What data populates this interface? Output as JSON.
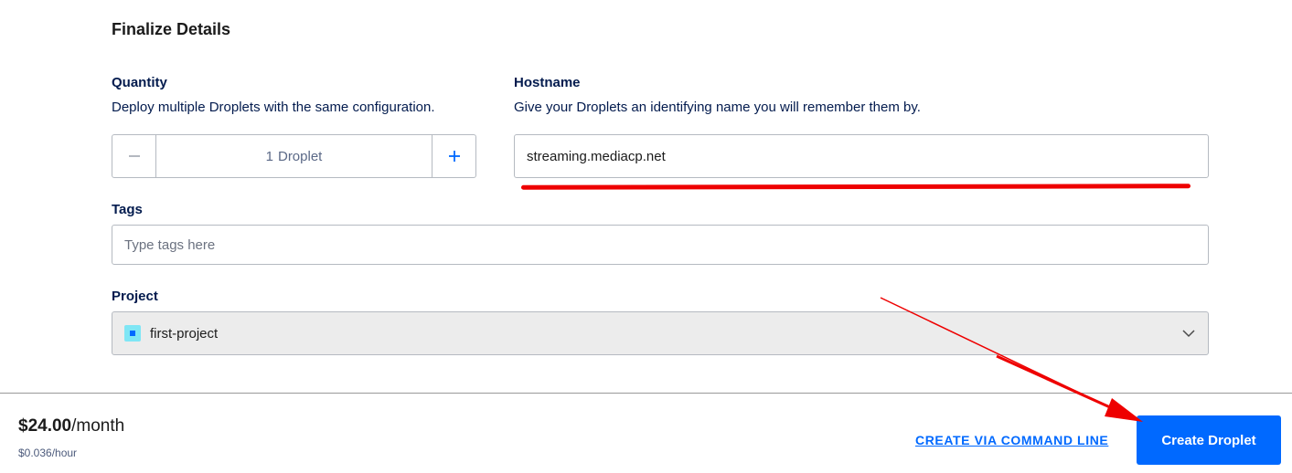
{
  "section": {
    "title": "Finalize Details"
  },
  "quantity": {
    "label": "Quantity",
    "description": "Deploy multiple Droplets with the same configuration.",
    "value": "1",
    "unit": "Droplet"
  },
  "hostname": {
    "label": "Hostname",
    "description": "Give your Droplets an identifying name you will remember them by.",
    "value": "streaming.mediacp.net"
  },
  "tags": {
    "label": "Tags",
    "placeholder": "Type tags here"
  },
  "project": {
    "label": "Project",
    "selected": "first-project"
  },
  "footer": {
    "price_amount": "$24.00",
    "price_period": "/month",
    "hourly": "$0.036/hour",
    "cli_link": "CREATE VIA COMMAND LINE",
    "create_button": "Create Droplet"
  },
  "colors": {
    "primary": "#0069ff",
    "annotation": "#ee0000",
    "text_dark": "#031b4e"
  },
  "icons": {
    "minus": "minus-icon",
    "plus": "plus-icon",
    "project": "project-square-icon",
    "dropdown": "chevron-down-icon"
  }
}
